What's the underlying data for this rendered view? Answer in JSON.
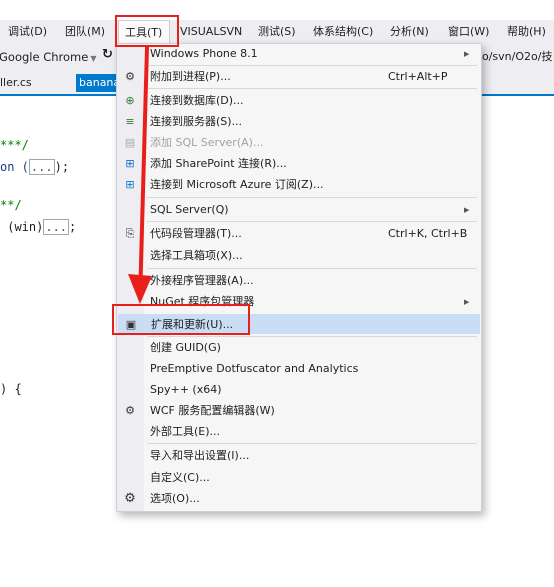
{
  "menubar": {
    "items": [
      {
        "label": "调试(D)"
      },
      {
        "label": "团队(M)"
      },
      {
        "label": "工具(T)"
      },
      {
        "label": "VISUALSVN"
      },
      {
        "label": "测试(S)"
      },
      {
        "label": "体系结构(C)"
      },
      {
        "label": "分析(N)"
      },
      {
        "label": "窗口(W)"
      },
      {
        "label": "帮助(H)"
      }
    ]
  },
  "toolbar": {
    "browser": "Google Chrome",
    "path": "o/svn/O2o/技"
  },
  "tabs": [
    {
      "label": "ller.cs"
    },
    {
      "label": "banana"
    }
  ],
  "code": {
    "line1": "***/",
    "line2_a": "on (",
    "line2_b": "...",
    "line2_c": ");",
    "line3": "**/",
    "line4_a": " (win)",
    "line4_b": "...",
    "line4_c": ";",
    "line5": ") {"
  },
  "tools_menu": {
    "items": [
      {
        "label": "Windows Phone 8.1",
        "submenu": true
      },
      {
        "label": "附加到进程(P)...",
        "shortcut": "Ctrl+Alt+P",
        "icon": "attach-icon"
      },
      {
        "label": "连接到数据库(D)...",
        "icon": "database-connect-icon"
      },
      {
        "label": "连接到服务器(S)...",
        "icon": "server-connect-icon"
      },
      {
        "label": "添加 SQL Server(A)...",
        "disabled": true,
        "icon": "sql-add-icon"
      },
      {
        "label": "添加 SharePoint 连接(R)...",
        "icon": "sharepoint-icon"
      },
      {
        "label": "连接到 Microsoft Azure 订阅(Z)...",
        "icon": "windows-azure-icon"
      },
      {
        "label": "SQL Server(Q)",
        "submenu": true
      },
      {
        "label": "代码段管理器(T)...",
        "shortcut": "Ctrl+K, Ctrl+B",
        "icon": "snippet-icon"
      },
      {
        "label": "选择工具箱项(X)..."
      },
      {
        "label": "外接程序管理器(A)..."
      },
      {
        "label": "NuGet 程序包管理器",
        "submenu": true
      },
      {
        "label": "扩展和更新(U)...",
        "highlighted": true,
        "icon": "extensions-icon"
      },
      {
        "label": "创建 GUID(G)"
      },
      {
        "label": "PreEmptive Dotfuscator and Analytics"
      },
      {
        "label": "Spy++ (x64)"
      },
      {
        "label": "WCF 服务配置编辑器(W)",
        "icon": "wcf-config-icon"
      },
      {
        "label": "外部工具(E)..."
      },
      {
        "label": "导入和导出设置(I)..."
      },
      {
        "label": "自定义(C)..."
      },
      {
        "label": "选项(O)...",
        "icon": "gear-icon"
      }
    ]
  },
  "colors": {
    "highlight": "#c9def5",
    "annotation": "#e8201c",
    "accent": "#007acc"
  }
}
